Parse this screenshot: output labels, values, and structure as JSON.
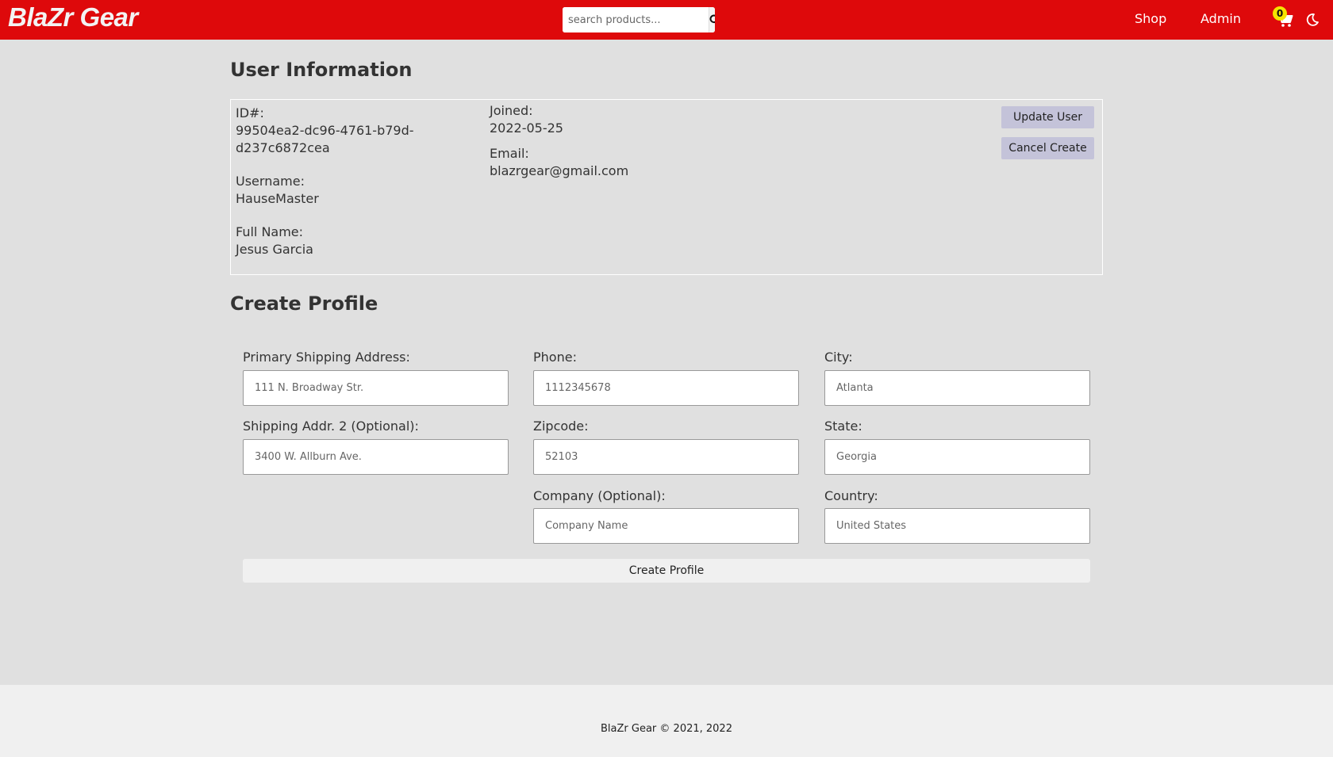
{
  "navbar": {
    "brand": "BlaZr Gear",
    "search_placeholder": "search products...",
    "search_icon": "search-icon",
    "links": {
      "shop": "Shop",
      "admin": "Admin"
    },
    "cart_count": "0",
    "cart_icon": "cart-icon",
    "theme_icon": "moon-icon",
    "bg_color": "#de090b"
  },
  "user_info": {
    "title": "User Information",
    "id_label": "ID#:",
    "id_value_line1": "99504ea2-dc96-4761-b79d-",
    "id_value_line2": "d237c6872cea",
    "username_label": "Username:",
    "username_value": "HauseMaster",
    "fullname_label": "Full Name:",
    "fullname_value": "Jesus Garcia",
    "joined_label": "Joined:",
    "joined_value": "2022-05-25",
    "email_label": "Email:",
    "email_value": "blazrgear@gmail.com",
    "update_button": "Update User",
    "cancel_button": "Cancel Create"
  },
  "profile_form": {
    "title": "Create Profile",
    "fields": {
      "shipping1": {
        "label": "Primary Shipping Address:",
        "placeholder": "111 N. Broadway Str."
      },
      "shipping2": {
        "label": "Shipping Addr. 2 (Optional):",
        "placeholder": "3400 W. Allburn Ave."
      },
      "phone": {
        "label": "Phone:",
        "placeholder": "1112345678"
      },
      "zipcode": {
        "label": "Zipcode:",
        "placeholder": "52103"
      },
      "company": {
        "label": "Company (Optional):",
        "placeholder": "Company Name"
      },
      "city": {
        "label": "City:",
        "placeholder": "Atlanta"
      },
      "state": {
        "label": "State:",
        "placeholder": "Georgia"
      },
      "country": {
        "label": "Country:",
        "placeholder": "United States"
      }
    },
    "submit_button": "Create Profile"
  },
  "footer": {
    "text": "BlaZr Gear © 2021, 2022"
  }
}
